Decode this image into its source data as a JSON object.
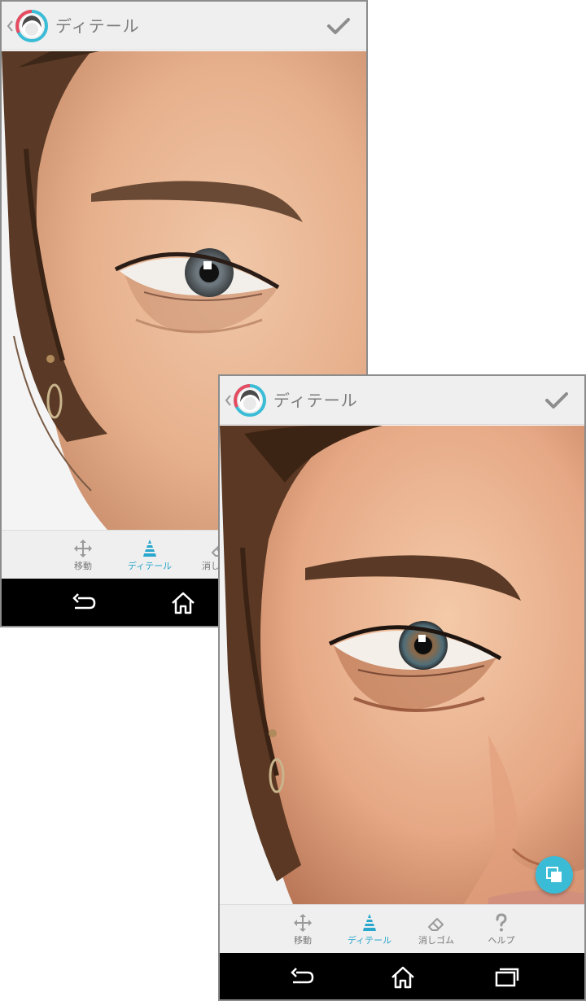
{
  "colors": {
    "accent": "#2aa7cc",
    "fab": "#3bbcd6",
    "appbar_bg": "#efefef",
    "navbar_bg": "#000000"
  },
  "screens": [
    {
      "title": "ディテール",
      "icons": [
        "back-chevron-icon",
        "facetune-logo-icon",
        "checkmark-icon"
      ],
      "tools": [
        {
          "label": "移動",
          "icon": "move-arrows-icon",
          "active": false
        },
        {
          "label": "ディテール",
          "icon": "detail-pyramid-icon",
          "active": true
        },
        {
          "label": "消しゴム",
          "icon": "eraser-icon",
          "active": false
        }
      ],
      "nav": [
        "back-icon",
        "home-icon"
      ]
    },
    {
      "title": "ディテール",
      "icons": [
        "back-chevron-icon",
        "facetune-logo-icon",
        "checkmark-icon",
        "compare-icon"
      ],
      "tools": [
        {
          "label": "移動",
          "icon": "move-arrows-icon",
          "active": false
        },
        {
          "label": "ディテール",
          "icon": "detail-pyramid-icon",
          "active": true
        },
        {
          "label": "消しゴム",
          "icon": "eraser-icon",
          "active": false
        },
        {
          "label": "ヘルプ",
          "icon": "help-question-icon",
          "active": false
        }
      ],
      "nav": [
        "back-icon",
        "home-icon",
        "recent-apps-icon"
      ]
    }
  ]
}
